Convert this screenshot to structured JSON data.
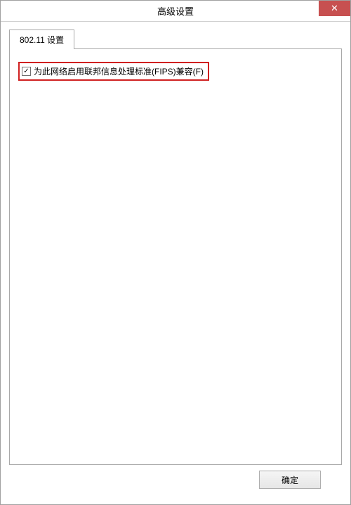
{
  "window": {
    "title": "高级设置",
    "close_symbol": "✕"
  },
  "tabs": [
    {
      "label": "802.11 设置"
    }
  ],
  "settings": {
    "fips_checkbox": {
      "checked_mark": "✓",
      "label": "为此网络启用联邦信息处理标准(FIPS)兼容(F)"
    }
  },
  "buttons": {
    "ok": "确定"
  }
}
